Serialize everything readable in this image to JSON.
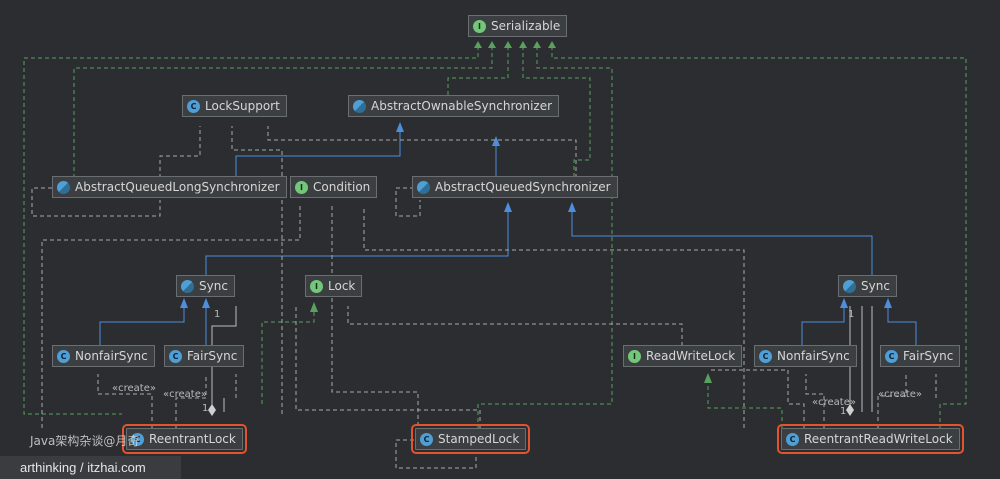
{
  "nodes": {
    "serializable": {
      "label": "Serializable",
      "kind": "i"
    },
    "lock_support": {
      "label": "LockSupport",
      "kind": "c"
    },
    "abstract_ownable_synchronizer": {
      "label": "AbstractOwnableSynchronizer",
      "kind": "a"
    },
    "abstract_queued_long_synchronizer": {
      "label": "AbstractQueuedLongSynchronizer",
      "kind": "a"
    },
    "condition": {
      "label": "Condition",
      "kind": "i"
    },
    "abstract_queued_synchronizer": {
      "label": "AbstractQueuedSynchronizer",
      "kind": "a"
    },
    "sync_left": {
      "label": "Sync",
      "kind": "a"
    },
    "lock": {
      "label": "Lock",
      "kind": "i"
    },
    "sync_right": {
      "label": "Sync",
      "kind": "a"
    },
    "nonfair_sync_left": {
      "label": "NonfairSync",
      "kind": "c"
    },
    "fair_sync_left": {
      "label": "FairSync",
      "kind": "c"
    },
    "read_write_lock": {
      "label": "ReadWriteLock",
      "kind": "i"
    },
    "nonfair_sync_right": {
      "label": "NonfairSync",
      "kind": "c"
    },
    "fair_sync_right": {
      "label": "FairSync",
      "kind": "c"
    },
    "reentrant_lock": {
      "label": "ReentrantLock",
      "kind": "c"
    },
    "stamped_lock": {
      "label": "StampedLock",
      "kind": "c"
    },
    "reentrant_read_write_lock": {
      "label": "ReentrantReadWriteLock",
      "kind": "c"
    }
  },
  "edge_labels": {
    "create_1": "«create»",
    "create_2": "«create»",
    "create_3": "«create»",
    "create_4": "«create»",
    "mult_left_sync": "1",
    "mult_left_lock": "1",
    "mult_right_sync": "1",
    "mult_right_lock": "1"
  },
  "watermark": "Java架构杂谈@月奇",
  "footer": "arthinking / itzhai.com",
  "colors": {
    "background": "#2b2d30",
    "inherit_blue": "#4d8fdc",
    "implement_green": "#5aa05f",
    "dependency_gray": "#a9a9a9",
    "highlight": "#e2532e"
  }
}
